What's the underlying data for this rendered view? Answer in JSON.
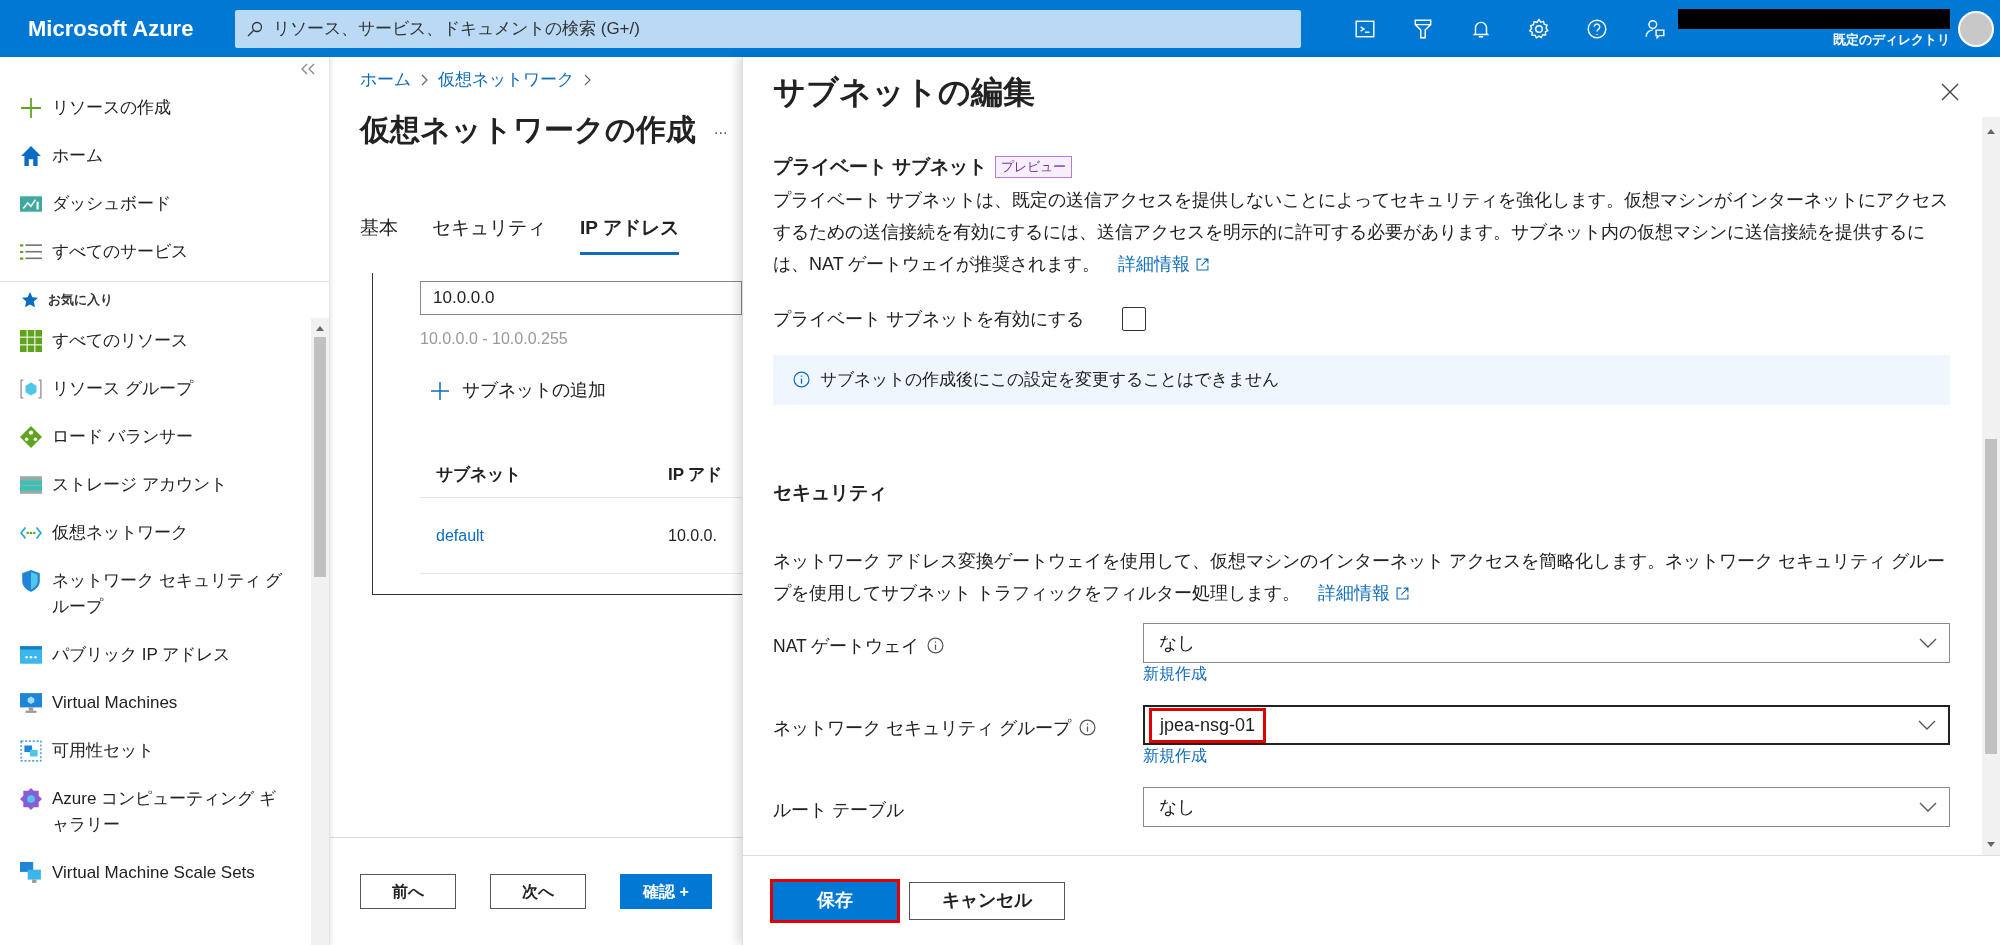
{
  "topbar": {
    "brand": "Microsoft Azure",
    "search": {
      "placeholder": "リソース、サービス、ドキュメントの検索 (G+/)"
    },
    "directory": "既定のディレクトリ"
  },
  "sidebar": {
    "top_items": [
      {
        "label": "リソースの作成",
        "kind": "plus"
      },
      {
        "label": "ホーム",
        "kind": "home"
      },
      {
        "label": "ダッシュボード",
        "kind": "dashboard"
      },
      {
        "label": "すべてのサービス",
        "kind": "list"
      }
    ],
    "favorites_label": "お気に入り",
    "favorites": [
      {
        "label": "すべてのリソース",
        "kind": "grid"
      },
      {
        "label": "リソース グループ",
        "kind": "cube"
      },
      {
        "label": "ロード バランサー",
        "kind": "diamond"
      },
      {
        "label": "ストレージ アカウント",
        "kind": "storage"
      },
      {
        "label": "仮想ネットワーク",
        "kind": "network"
      },
      {
        "label": "ネットワーク セキュリティ グループ",
        "kind": "shield"
      },
      {
        "label": "パブリック IP アドレス",
        "kind": "ip"
      },
      {
        "label": "Virtual Machines",
        "kind": "monitor"
      },
      {
        "label": "可用性セット",
        "kind": "availability"
      },
      {
        "label": "Azure コンピューティング ギャラリー",
        "kind": "gallery"
      },
      {
        "label": "Virtual Machine Scale Sets",
        "kind": "scaleset"
      }
    ]
  },
  "main": {
    "breadcrumb": [
      "ホーム",
      "仮想ネットワーク"
    ],
    "title": "仮想ネットワークの作成",
    "more": "...",
    "tabs": [
      {
        "label": "基本",
        "selected": false
      },
      {
        "label": "セキュリティ",
        "selected": false
      },
      {
        "label": "IP アドレス",
        "selected": true
      }
    ],
    "address_value": "10.0.0.0",
    "address_range": "10.0.0.0 - 10.0.0.255",
    "add_subnet": "サブネットの追加",
    "table": {
      "columns": [
        "サブネット",
        "IP アド"
      ],
      "rows": [
        [
          "default",
          "10.0.0."
        ]
      ]
    },
    "footer_buttons": [
      {
        "label": "前へ",
        "kind": "secondary"
      },
      {
        "label": "次へ",
        "kind": "secondary"
      },
      {
        "label": "確認 +",
        "kind": "primary"
      }
    ]
  },
  "panel": {
    "title": "サブネットの編集",
    "private_subnet": {
      "heading": "プライベート サブネット",
      "badge": "プレビュー",
      "description": "プライベート サブネットは、既定の送信アクセスを提供しないことによってセキュリティを強化します。仮想マシンがインターネットにアクセスするための送信接続を有効にするには、送信アクセスを明示的に許可する必要があります。サブネット内の仮想マシンに送信接続を提供するには、NAT ゲートウェイが推奨されます。",
      "link": "詳細情報",
      "checkbox": {
        "label": "プライベート サブネットを有効にする",
        "checked": false
      },
      "info": "サブネットの作成後にこの設定を変更することはできません"
    },
    "security": {
      "heading": "セキュリティ",
      "description": "ネットワーク アドレス変換ゲートウェイを使用して、仮想マシンのインターネット アクセスを簡略化します。ネットワーク セキュリティ グループを使用してサブネット トラフィックをフィルター処理します。",
      "link": "詳細情報",
      "fields": [
        {
          "label": "NAT ゲートウェイ",
          "info_icon": true,
          "value": "なし",
          "create_link": "新規作成",
          "highlighted": false
        },
        {
          "label": "ネットワーク セキュリティ グループ",
          "info_icon": true,
          "value": "jpea-nsg-01",
          "create_link": "新規作成",
          "highlighted": true
        },
        {
          "label": "ルート テーブル",
          "info_icon": false,
          "value": "なし",
          "highlighted": false
        }
      ]
    },
    "buttons": [
      {
        "label": "保存",
        "kind": "primary",
        "highlighted": true
      },
      {
        "label": "キャンセル",
        "kind": "secondary",
        "highlighted": false
      }
    ]
  }
}
